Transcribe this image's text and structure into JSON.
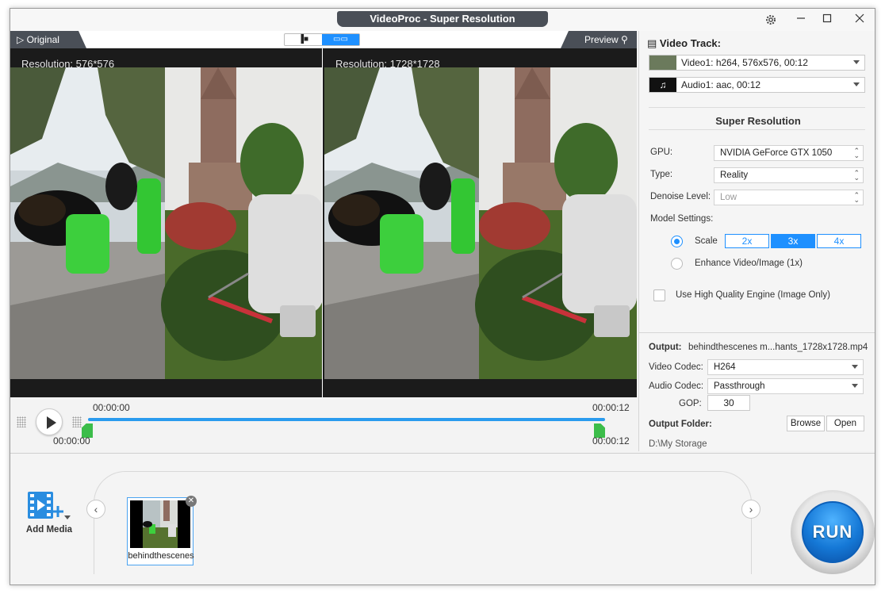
{
  "window": {
    "title": "VideoProc  -  Super Resolution",
    "icons": [
      "gear-icon",
      "minimize-icon",
      "maximize-icon",
      "close-icon"
    ]
  },
  "preview": {
    "original_tab": "Original",
    "preview_tab": "Preview",
    "left_resolution": "Resolution: 576*576",
    "right_resolution": "Resolution: 1728*1728"
  },
  "timeline": {
    "start_top": "00:00:00",
    "end_top": "00:00:12",
    "start_bottom": "00:00:00",
    "end_bottom": "00:00:12"
  },
  "panel": {
    "video_track_title": "Video Track:",
    "video_track": "Video1: h264, 576x576, 00:12",
    "audio_track": "Audio1: aac, 00:12",
    "section_title": "Super Resolution",
    "gpu_label": "GPU:",
    "gpu_value": "NVIDIA GeForce GTX 1050",
    "type_label": "Type:",
    "type_value": "Reality",
    "denoise_label": "Denoise Level:",
    "denoise_value": "Low",
    "model_label": "Model Settings:",
    "scale_label": "Scale",
    "scale_options": [
      "2x",
      "3x",
      "4x"
    ],
    "scale_selected": "3x",
    "enhance_label": "Enhance Video/Image (1x)",
    "hq_label": "Use High Quality Engine (Image Only)"
  },
  "output": {
    "output_label": "Output:",
    "output_file": "behindthescenes  m...hants_1728x1728.mp4",
    "video_codec_label": "Video Codec:",
    "video_codec": "H264",
    "audio_codec_label": "Audio Codec:",
    "audio_codec": "Passthrough",
    "gop_label": "GOP:",
    "gop_value": "30",
    "folder_label": "Output Folder:",
    "browse": "Browse",
    "open": "Open",
    "folder_path": "D:\\My Storage"
  },
  "bottom": {
    "add_media": "Add Media",
    "clip_name": "behindthescenes",
    "run": "RUN"
  }
}
